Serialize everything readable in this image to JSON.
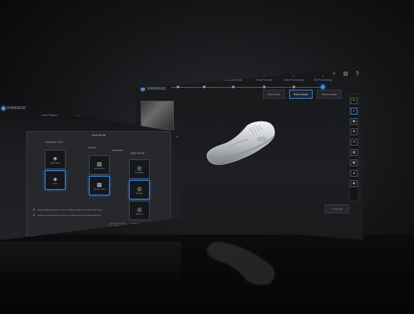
{
  "main": {
    "logo_text": "SHINING3D",
    "steps": [
      {
        "n": "1",
        "label": "Scan Project"
      },
      {
        "n": "2",
        "label": "Scan Mode",
        "sub": "Standard Scan"
      },
      {
        "n": "3",
        "label": "Standard Scan"
      },
      {
        "n": "4",
        "label": "Post-Process"
      },
      {
        "n": "5",
        "label": "Data Processing"
      },
      {
        "n": "6",
        "label": "3D Processing"
      }
    ],
    "view_buttons": [
      "Raw Data",
      "Point Cloud",
      "Mesh Model"
    ],
    "generate_label": "Generate"
  },
  "dialog": {
    "logo_text": "SHINING3D",
    "steps": [
      "Scan Project",
      "Scan Mode",
      "Standard Scan"
    ],
    "title": "Scan Mode",
    "col1_label": "Standard Scan",
    "col2_label": "Texture",
    "col3_label": "Turntable",
    "col4_label": "Align Mode",
    "options": {
      "a1": "Light Scan",
      "a2": "Scan",
      "b1": "Non-texture",
      "b2": "Texture Scan",
      "c1": "Turntable",
      "c2": "Feature",
      "c3": "Markers"
    },
    "note1": "Please place the object on the turntable, at least ten markers per frame",
    "note2": "Markers: Increasing the number of markers helps accurate alignment",
    "back_label": "Back",
    "next_label": "Next"
  }
}
